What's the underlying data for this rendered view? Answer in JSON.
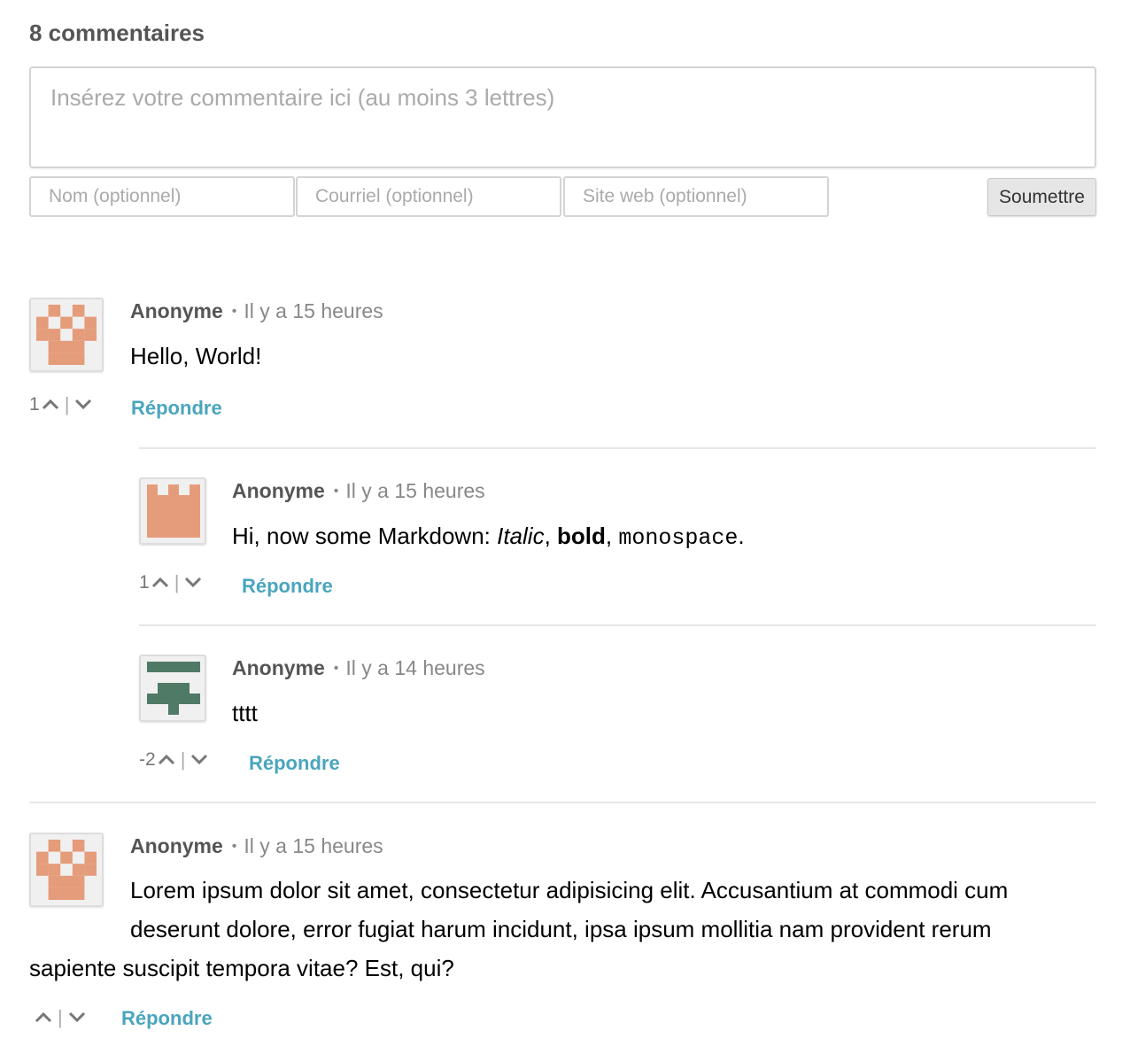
{
  "header": {
    "count_label": "8 commentaires"
  },
  "form": {
    "comment_placeholder": "Insérez votre commentaire ici (au moins 3 lettres)",
    "name_placeholder": "Nom (optionnel)",
    "email_placeholder": "Courriel (optionnel)",
    "website_placeholder": "Site web (optionnel)",
    "submit_label": "Soumettre"
  },
  "colors": {
    "reply_link": "#4aa5bd",
    "avatar_orange": "#e59c7a",
    "avatar_green": "#4e7a66"
  },
  "comments": [
    {
      "author": "Anonyme",
      "separator": "•",
      "time": "Il y a 15 heures",
      "text": "Hello, World!",
      "score": "1",
      "reply_label": "Répondre",
      "avatar_icon": "identicon-orange"
    },
    {
      "author": "Anonyme",
      "separator": "•",
      "time": "Il y a 15 heures",
      "text_prefix": "Hi, now some Markdown: ",
      "text_italic": "Italic",
      "text_comma1": ", ",
      "text_bold": "bold",
      "text_comma2": ", ",
      "text_mono": "monospace",
      "text_end": ".",
      "score": "1",
      "reply_label": "Répondre",
      "avatar_icon": "identicon-orange"
    },
    {
      "author": "Anonyme",
      "separator": "•",
      "time": "Il y a 14 heures",
      "text": "tttt",
      "score": "-2",
      "reply_label": "Répondre",
      "avatar_icon": "identicon-green"
    },
    {
      "author": "Anonyme",
      "separator": "•",
      "time": "Il y a 15 heures",
      "text_line1": "Lorem ipsum dolor sit amet, consectetur adipisicing elit. Accusantium at commodi cum",
      "text_line2": "deserunt dolore, error fugiat harum incidunt, ipsa ipsum mollitia nam provident rerum",
      "text_line3": "sapiente suscipit tempora vitae? Est, qui?",
      "score": "",
      "reply_label": "Répondre",
      "avatar_icon": "identicon-orange"
    }
  ],
  "vote_separator": "|"
}
